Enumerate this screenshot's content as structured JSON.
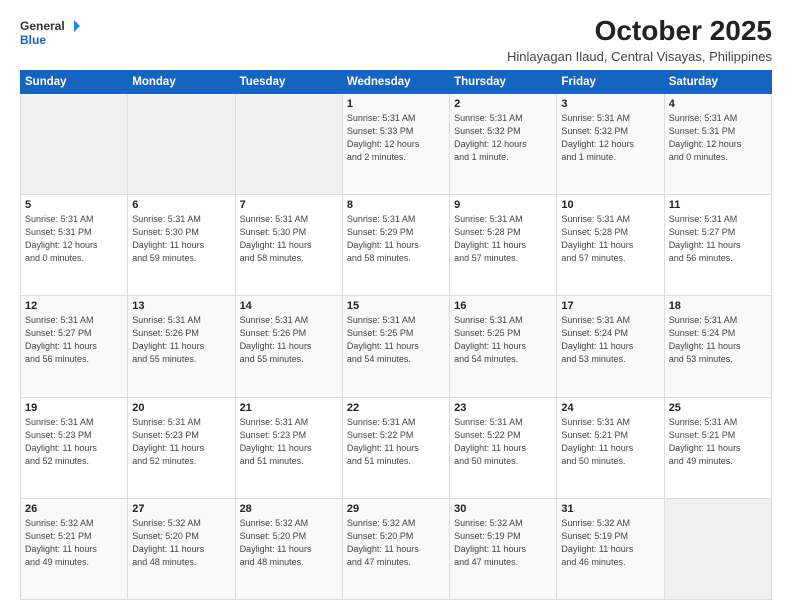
{
  "header": {
    "logo_general": "General",
    "logo_blue": "Blue",
    "month_title": "October 2025",
    "subtitle": "Hinlayagan Ilaud, Central Visayas, Philippines"
  },
  "days_of_week": [
    "Sunday",
    "Monday",
    "Tuesday",
    "Wednesday",
    "Thursday",
    "Friday",
    "Saturday"
  ],
  "weeks": [
    [
      {
        "day": "",
        "info": ""
      },
      {
        "day": "",
        "info": ""
      },
      {
        "day": "",
        "info": ""
      },
      {
        "day": "1",
        "info": "Sunrise: 5:31 AM\nSunset: 5:33 PM\nDaylight: 12 hours\nand 2 minutes."
      },
      {
        "day": "2",
        "info": "Sunrise: 5:31 AM\nSunset: 5:32 PM\nDaylight: 12 hours\nand 1 minute."
      },
      {
        "day": "3",
        "info": "Sunrise: 5:31 AM\nSunset: 5:32 PM\nDaylight: 12 hours\nand 1 minute."
      },
      {
        "day": "4",
        "info": "Sunrise: 5:31 AM\nSunset: 5:31 PM\nDaylight: 12 hours\nand 0 minutes."
      }
    ],
    [
      {
        "day": "5",
        "info": "Sunrise: 5:31 AM\nSunset: 5:31 PM\nDaylight: 12 hours\nand 0 minutes."
      },
      {
        "day": "6",
        "info": "Sunrise: 5:31 AM\nSunset: 5:30 PM\nDaylight: 11 hours\nand 59 minutes."
      },
      {
        "day": "7",
        "info": "Sunrise: 5:31 AM\nSunset: 5:30 PM\nDaylight: 11 hours\nand 58 minutes."
      },
      {
        "day": "8",
        "info": "Sunrise: 5:31 AM\nSunset: 5:29 PM\nDaylight: 11 hours\nand 58 minutes."
      },
      {
        "day": "9",
        "info": "Sunrise: 5:31 AM\nSunset: 5:28 PM\nDaylight: 11 hours\nand 57 minutes."
      },
      {
        "day": "10",
        "info": "Sunrise: 5:31 AM\nSunset: 5:28 PM\nDaylight: 11 hours\nand 57 minutes."
      },
      {
        "day": "11",
        "info": "Sunrise: 5:31 AM\nSunset: 5:27 PM\nDaylight: 11 hours\nand 56 minutes."
      }
    ],
    [
      {
        "day": "12",
        "info": "Sunrise: 5:31 AM\nSunset: 5:27 PM\nDaylight: 11 hours\nand 56 minutes."
      },
      {
        "day": "13",
        "info": "Sunrise: 5:31 AM\nSunset: 5:26 PM\nDaylight: 11 hours\nand 55 minutes."
      },
      {
        "day": "14",
        "info": "Sunrise: 5:31 AM\nSunset: 5:26 PM\nDaylight: 11 hours\nand 55 minutes."
      },
      {
        "day": "15",
        "info": "Sunrise: 5:31 AM\nSunset: 5:25 PM\nDaylight: 11 hours\nand 54 minutes."
      },
      {
        "day": "16",
        "info": "Sunrise: 5:31 AM\nSunset: 5:25 PM\nDaylight: 11 hours\nand 54 minutes."
      },
      {
        "day": "17",
        "info": "Sunrise: 5:31 AM\nSunset: 5:24 PM\nDaylight: 11 hours\nand 53 minutes."
      },
      {
        "day": "18",
        "info": "Sunrise: 5:31 AM\nSunset: 5:24 PM\nDaylight: 11 hours\nand 53 minutes."
      }
    ],
    [
      {
        "day": "19",
        "info": "Sunrise: 5:31 AM\nSunset: 5:23 PM\nDaylight: 11 hours\nand 52 minutes."
      },
      {
        "day": "20",
        "info": "Sunrise: 5:31 AM\nSunset: 5:23 PM\nDaylight: 11 hours\nand 52 minutes."
      },
      {
        "day": "21",
        "info": "Sunrise: 5:31 AM\nSunset: 5:23 PM\nDaylight: 11 hours\nand 51 minutes."
      },
      {
        "day": "22",
        "info": "Sunrise: 5:31 AM\nSunset: 5:22 PM\nDaylight: 11 hours\nand 51 minutes."
      },
      {
        "day": "23",
        "info": "Sunrise: 5:31 AM\nSunset: 5:22 PM\nDaylight: 11 hours\nand 50 minutes."
      },
      {
        "day": "24",
        "info": "Sunrise: 5:31 AM\nSunset: 5:21 PM\nDaylight: 11 hours\nand 50 minutes."
      },
      {
        "day": "25",
        "info": "Sunrise: 5:31 AM\nSunset: 5:21 PM\nDaylight: 11 hours\nand 49 minutes."
      }
    ],
    [
      {
        "day": "26",
        "info": "Sunrise: 5:32 AM\nSunset: 5:21 PM\nDaylight: 11 hours\nand 49 minutes."
      },
      {
        "day": "27",
        "info": "Sunrise: 5:32 AM\nSunset: 5:20 PM\nDaylight: 11 hours\nand 48 minutes."
      },
      {
        "day": "28",
        "info": "Sunrise: 5:32 AM\nSunset: 5:20 PM\nDaylight: 11 hours\nand 48 minutes."
      },
      {
        "day": "29",
        "info": "Sunrise: 5:32 AM\nSunset: 5:20 PM\nDaylight: 11 hours\nand 47 minutes."
      },
      {
        "day": "30",
        "info": "Sunrise: 5:32 AM\nSunset: 5:19 PM\nDaylight: 11 hours\nand 47 minutes."
      },
      {
        "day": "31",
        "info": "Sunrise: 5:32 AM\nSunset: 5:19 PM\nDaylight: 11 hours\nand 46 minutes."
      },
      {
        "day": "",
        "info": ""
      }
    ]
  ]
}
